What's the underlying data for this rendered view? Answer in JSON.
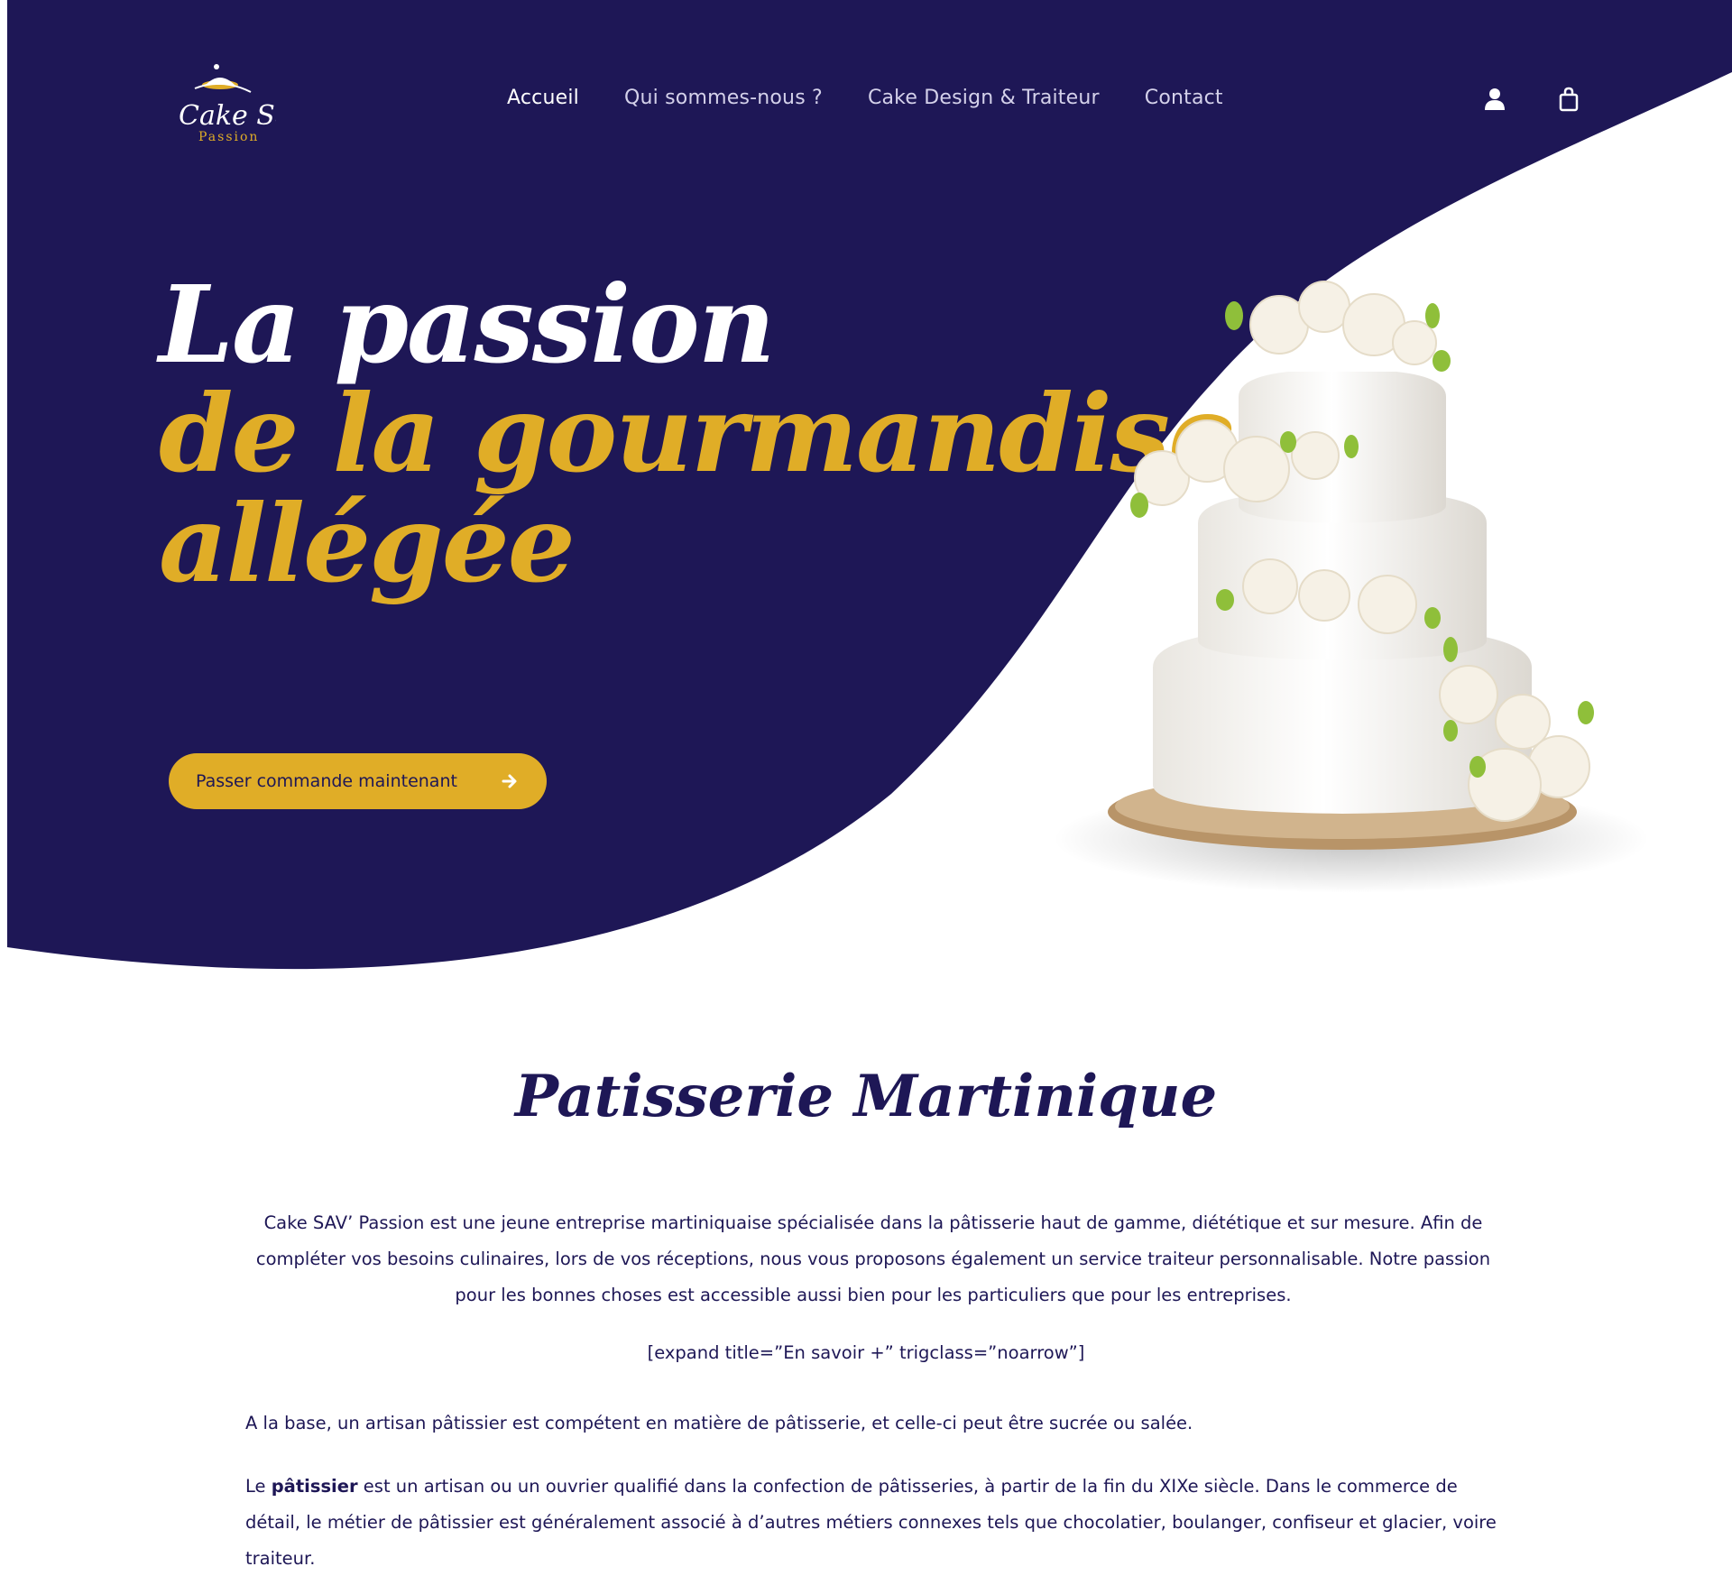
{
  "brand": {
    "logo_line1": "Cake Sav'",
    "logo_line2": "Passion"
  },
  "nav": {
    "items": [
      "Accueil",
      "Qui sommes-nous ?",
      "Cake Design & Traiteur",
      "Contact"
    ],
    "active": "Accueil"
  },
  "header_icons": [
    "user-icon",
    "shopping-bag-icon"
  ],
  "hero": {
    "title_line1": "La passion",
    "title_line2": "de la gourmandise",
    "title_line3": "allégée",
    "cta_label": "Passer commande maintenant",
    "cta_icon": "arrow-right-icon"
  },
  "content": {
    "section_title": "Patisserie Martinique",
    "intro": "Cake SAV’ Passion est une jeune entreprise martiniquaise spécialisée dans la pâtisserie haut de gamme, diététique et sur mesure. Afin de compléter vos besoins culinaires, lors de vos réceptions, nous vous proposons également un service traiteur personnalisable. Notre passion pour les bonnes choses est accessible aussi bien pour les particuliers que pour les entreprises.",
    "shortcode": "[expand title=”En savoir +” trigclass=”noarrow”]",
    "paragraph_base": "A la base, un artisan pâtissier est compétent en matière de pâtisserie, et celle-ci peut être sucrée ou salée.",
    "paragraph_patissier_prefix": "Le ",
    "paragraph_patissier_bold": "pâtissier",
    "paragraph_patissier_rest": " est un artisan ou un ouvrier qualifié dans la confection de pâtisseries, à partir de la fin du XIXe siècle. Dans le commerce de détail, le métier de pâtissier est généralement associé à d’autres métiers connexes tels que chocolatier, boulanger, confiseur et glacier, voire traiteur."
  },
  "colors": {
    "navy": "#1e1756",
    "gold": "#e0ad27",
    "white": "#ffffff"
  }
}
